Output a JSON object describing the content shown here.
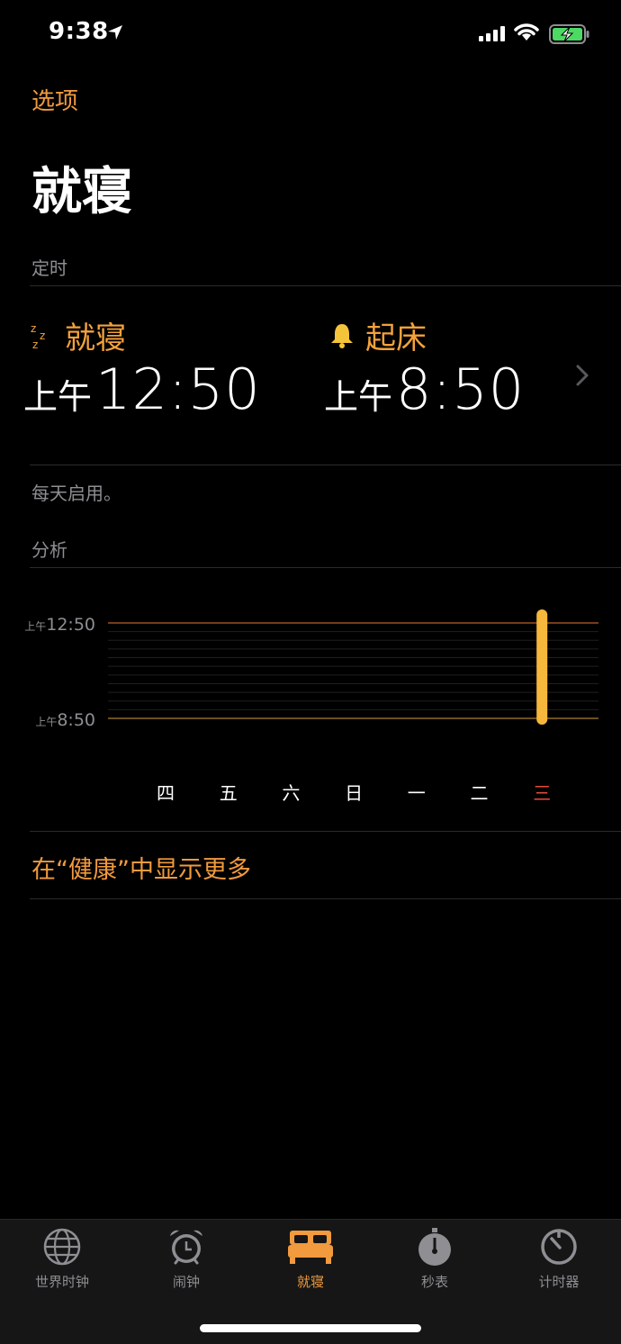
{
  "status_bar": {
    "time": "9:38"
  },
  "nav": {
    "options_label": "选项"
  },
  "page": {
    "title": "就寝"
  },
  "schedule": {
    "section_header": "定时",
    "bedtime": {
      "label": "就寝",
      "ampm": "上午",
      "time": "12:50",
      "icon": "zzz-icon"
    },
    "wake": {
      "label": "起床",
      "ampm": "上午",
      "time": "8:50",
      "icon": "bell-icon"
    },
    "footnote": "每天启用。"
  },
  "analysis": {
    "section_header": "分析",
    "health_link": "在“健康”中显示更多"
  },
  "chart_data": {
    "type": "bar",
    "y_labels": [
      {
        "ampm": "上午",
        "time": "12:50"
      },
      {
        "ampm": "上午",
        "time": "8:50"
      }
    ],
    "categories": [
      "四",
      "五",
      "六",
      "日",
      "一",
      "二",
      "三"
    ],
    "highlight_category": "三",
    "series": [
      {
        "values": [
          null,
          null,
          null,
          null,
          null,
          null,
          {
            "start": "12:50",
            "end": "8:50"
          }
        ]
      }
    ],
    "colors": {
      "bar": "#f5b73c",
      "top_line": "#e8783a",
      "bottom_line": "#d4a13a",
      "today": "#e84a3a"
    }
  },
  "tabbar": {
    "tabs": [
      {
        "label": "世界时钟",
        "icon": "globe-icon",
        "active": false
      },
      {
        "label": "闹钟",
        "icon": "alarm-clock-icon",
        "active": false
      },
      {
        "label": "就寝",
        "icon": "bed-icon",
        "active": true
      },
      {
        "label": "秒表",
        "icon": "stopwatch-icon",
        "active": false
      },
      {
        "label": "计时器",
        "icon": "timer-icon",
        "active": false
      }
    ]
  },
  "colors": {
    "accent": "#f19a3e",
    "secondary_text": "#8e8e93"
  }
}
